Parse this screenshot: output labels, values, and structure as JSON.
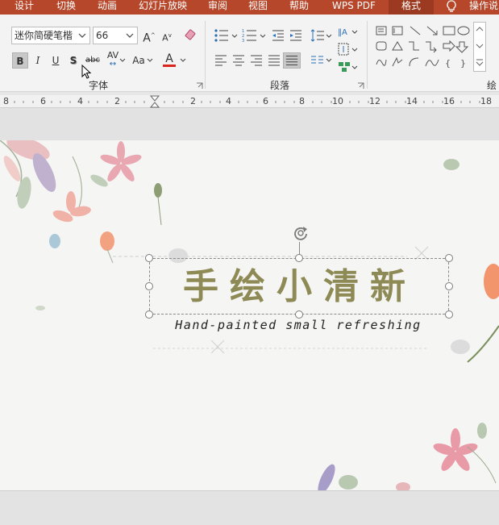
{
  "ribbon_tabs": [
    "设计",
    "切换",
    "动画",
    "幻灯片放映",
    "审阅",
    "视图",
    "帮助",
    "WPS PDF",
    "格式",
    "操作说"
  ],
  "active_tab": "格式",
  "font": {
    "name": "迷你简硬笔楷",
    "size": "66",
    "increase_label": "A",
    "decrease_label": "A",
    "bold": "B",
    "italic": "I",
    "underline": "U",
    "shadow": "S",
    "strikethrough": "abc",
    "spacing": "AV",
    "case": "Aa",
    "color_label": "A",
    "group_label": "字体"
  },
  "paragraph": {
    "group_label": "段落"
  },
  "drawing": {
    "group_label": "绘"
  },
  "ruler": [
    "8",
    "6",
    "4",
    "2",
    "2",
    "4",
    "6",
    "8",
    "10",
    "12",
    "14",
    "16",
    "18"
  ],
  "slide": {
    "title": "手绘小清新",
    "subtitle": "Hand-painted small refreshing"
  },
  "colors": {
    "ribbon_tab_bg": "#b7472a",
    "title_color": "#8e8a55",
    "font_color_bar": "#d9261c"
  },
  "icons": [
    "bulb-icon",
    "bullets-icon",
    "numbering-icon",
    "align-left-icon",
    "align-center-icon",
    "align-right-icon",
    "justify-icon",
    "columns-icon",
    "rotate-handle-icon",
    "mouse-cursor-icon"
  ]
}
